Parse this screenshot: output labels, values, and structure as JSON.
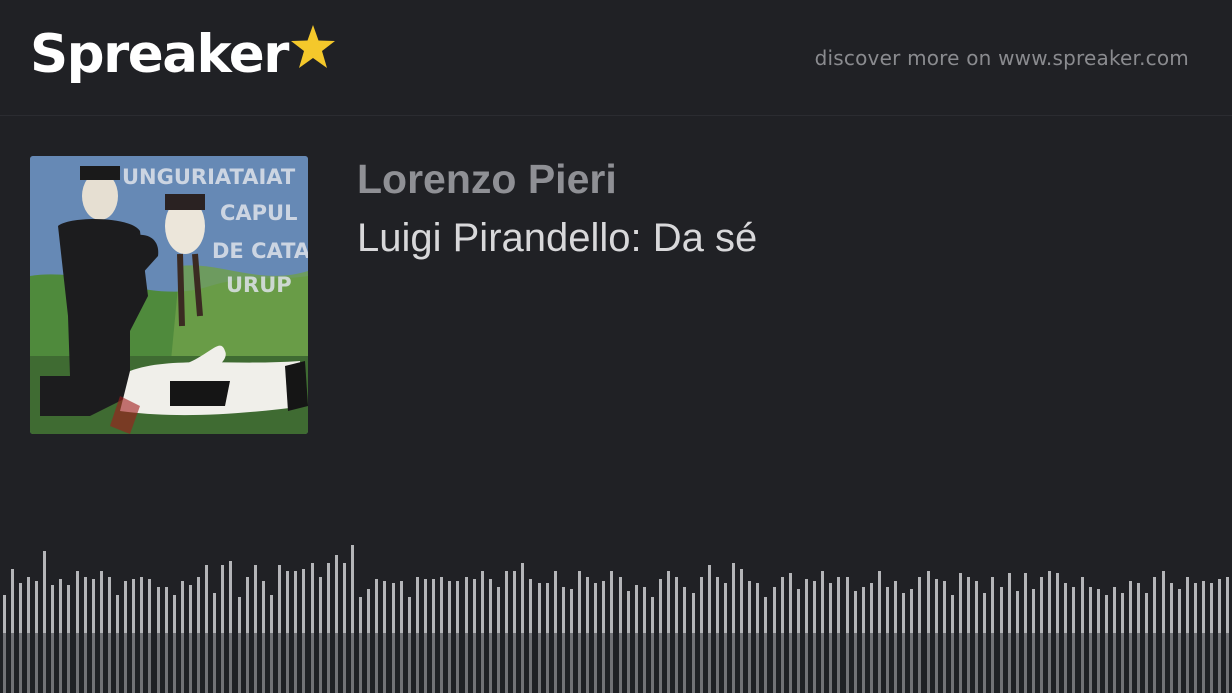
{
  "header": {
    "logo_text": "Spreaker",
    "discover_text": "discover more on www.spreaker.com"
  },
  "podcast": {
    "author": "Lorenzo Pieri",
    "episode_title": "Luigi Pirandello: Da sé",
    "cover_text_lines": [
      "UNGURIATAIAT",
      "CAPUL",
      "DE CATA",
      "URUP"
    ]
  },
  "player": {
    "waveform_levels": [
      0.49,
      0.62,
      0.55,
      0.58,
      0.56,
      0.71,
      0.54,
      0.57,
      0.54,
      0.61,
      0.58,
      0.57,
      0.61,
      0.58,
      0.49,
      0.56,
      0.57,
      0.58,
      0.57,
      0.53,
      0.53,
      0.49,
      0.56,
      0.54,
      0.58,
      0.64,
      0.5,
      0.64,
      0.66,
      0.48,
      0.58,
      0.64,
      0.56,
      0.49,
      0.64,
      0.61,
      0.61,
      0.62,
      0.65,
      0.58,
      0.65,
      0.69,
      0.65,
      0.74,
      0.48,
      0.52,
      0.57,
      0.56,
      0.55,
      0.56,
      0.48,
      0.58,
      0.57,
      0.57,
      0.58,
      0.56,
      0.56,
      0.58,
      0.57,
      0.61,
      0.57,
      0.53,
      0.61,
      0.61,
      0.65,
      0.57,
      0.55,
      0.55,
      0.61,
      0.53,
      0.52,
      0.61,
      0.58,
      0.55,
      0.56,
      0.61,
      0.58,
      0.51,
      0.54,
      0.53,
      0.48,
      0.57,
      0.61,
      0.58,
      0.53,
      0.5,
      0.58,
      0.64,
      0.58,
      0.55,
      0.65,
      0.62,
      0.56,
      0.55,
      0.48,
      0.53,
      0.58,
      0.6,
      0.52,
      0.57,
      0.56,
      0.61,
      0.55,
      0.58,
      0.58,
      0.51,
      0.53,
      0.55,
      0.61,
      0.53,
      0.56,
      0.5,
      0.52,
      0.58,
      0.61,
      0.57,
      0.56,
      0.49,
      0.6,
      0.58,
      0.56,
      0.5,
      0.58,
      0.53,
      0.6,
      0.51,
      0.6,
      0.52,
      0.58,
      0.61,
      0.6,
      0.55,
      0.53,
      0.58,
      0.53,
      0.52,
      0.49,
      0.53,
      0.5,
      0.56,
      0.55,
      0.5,
      0.58,
      0.61,
      0.55,
      0.52,
      0.58,
      0.55,
      0.56,
      0.55,
      0.57,
      0.58
    ],
    "waveform_color": "#b4b5b8",
    "background_color": "#202125"
  },
  "colors": {
    "logo_star": "#f4c82b",
    "author": "#8f9095",
    "title": "#d8d8da"
  }
}
